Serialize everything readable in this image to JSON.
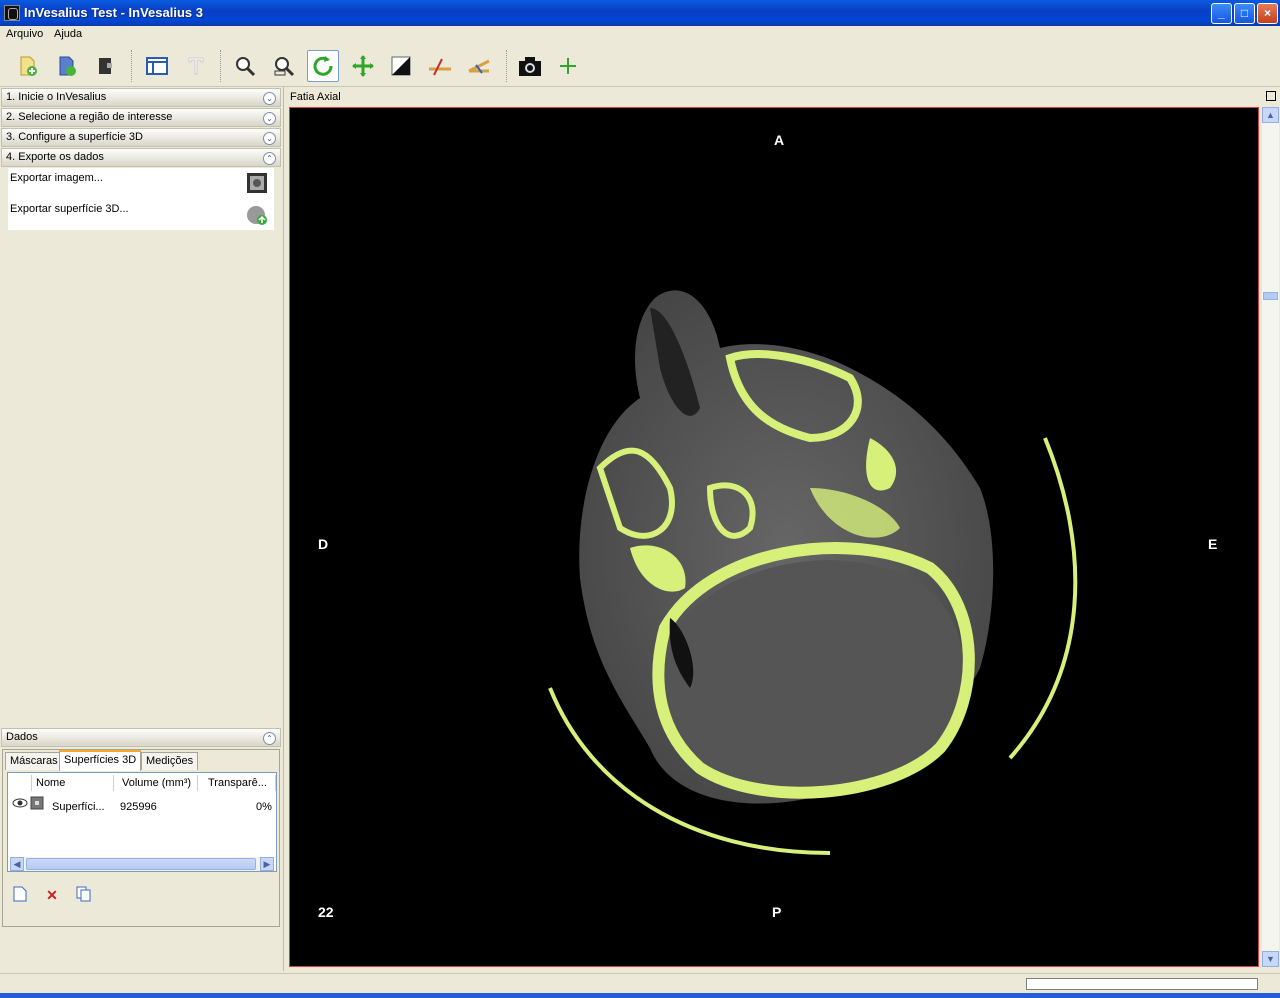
{
  "window": {
    "title": "InVesalius Test - InVesalius 3",
    "min": "_",
    "max": "□",
    "close": "×"
  },
  "menu": [
    "Arquivo",
    "Ajuda"
  ],
  "toolbar": [
    "import-icon",
    "open-icon",
    "close-project-icon",
    "layout-icon",
    "text-icon",
    "zoom-icon",
    "zoom-fit-icon",
    "rotate-icon",
    "pan-icon",
    "contrast-icon",
    "measure-linear-icon",
    "measure-angle-icon",
    "screenshot-icon",
    "add-icon"
  ],
  "left": {
    "folds": [
      {
        "label": "1. Inicie o InVesalius",
        "state": "collapsed"
      },
      {
        "label": "2. Selecione a região de interesse",
        "state": "collapsed"
      },
      {
        "label": "3. Configure a superfície 3D",
        "state": "collapsed"
      },
      {
        "label": "4. Exporte os dados",
        "state": "expanded"
      }
    ],
    "export_image": "Exportar imagem...",
    "export_surface": "Exportar superfície 3D...",
    "dados": {
      "title": "Dados",
      "tabs": [
        "Máscaras",
        "Superfícies 3D",
        "Medições"
      ],
      "columns": [
        "Nome",
        "Volume (mm³)",
        "Transparê..."
      ],
      "row": {
        "name": "Superfíci...",
        "volume": "925996",
        "transparency": "0%"
      }
    }
  },
  "viewer": {
    "title": "Fatia Axial",
    "labels": {
      "top": "A",
      "bottom": "P",
      "left": "D",
      "right": "E",
      "slice": "22"
    },
    "colors": {
      "bone": "#d6f07a",
      "tissue": "#6e6e6e",
      "background": "#000000"
    }
  }
}
